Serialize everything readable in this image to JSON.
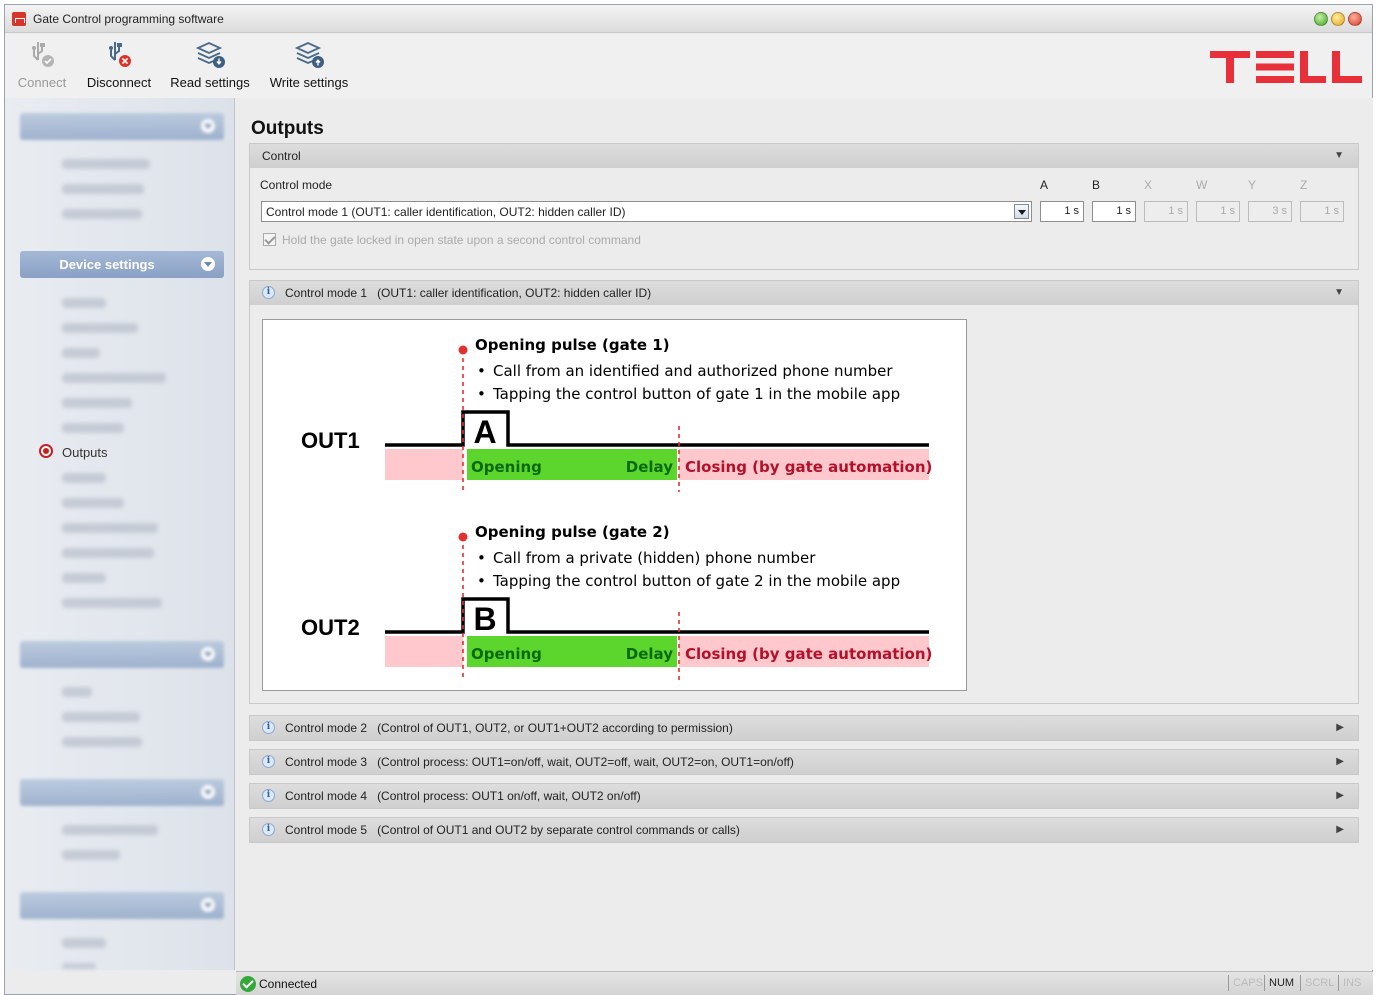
{
  "window": {
    "title": "Gate Control programming software"
  },
  "toolbar": {
    "connect": "Connect",
    "disconnect": "Disconnect",
    "read_settings": "Read settings",
    "write_settings": "Write settings",
    "logo": "TELL"
  },
  "sidebar": {
    "device_settings": "Device settings",
    "outputs": "Outputs"
  },
  "main": {
    "title": "Outputs",
    "control_panel": {
      "header": "Control",
      "control_mode_label": "Control mode",
      "selected_mode": "Control mode 1   (OUT1: caller identification, OUT2: hidden caller ID)",
      "timers": [
        {
          "label": "A",
          "value": "1 s",
          "enabled": true
        },
        {
          "label": "B",
          "value": "1 s",
          "enabled": true
        },
        {
          "label": "X",
          "value": "1 s",
          "enabled": false
        },
        {
          "label": "W",
          "value": "1 s",
          "enabled": false
        },
        {
          "label": "Y",
          "value": "3 s",
          "enabled": false
        },
        {
          "label": "Z",
          "value": "1 s",
          "enabled": false
        }
      ],
      "hold_checkbox": "Hold the gate locked in open state upon a second control command",
      "hold_checked": true
    },
    "modes": [
      {
        "name": "Control mode 1",
        "desc": "(OUT1: caller identification, OUT2: hidden caller ID)",
        "expanded": true
      },
      {
        "name": "Control mode 2",
        "desc": "(Control of OUT1, OUT2, or OUT1+OUT2 according to permission)",
        "expanded": false
      },
      {
        "name": "Control mode 3",
        "desc": "(Control process: OUT1=on/off, wait, OUT2=off, wait, OUT2=on, OUT1=on/off)",
        "expanded": false
      },
      {
        "name": "Control mode 4",
        "desc": "(Control process: OUT1 on/off, wait, OUT2 on/off)",
        "expanded": false
      },
      {
        "name": "Control mode 5",
        "desc": "(Control of OUT1 and OUT2 by separate control commands or calls)",
        "expanded": false
      }
    ],
    "diagram": {
      "out1": {
        "label": "OUT1",
        "pulse_title": "Opening pulse (gate 1)",
        "bullet1": "Call from an identified and authorized phone number",
        "bullet2": "Tapping the control button of gate 1 in the mobile app",
        "letter": "A",
        "opening": "Opening",
        "delay": "Delay",
        "closing": "Closing (by gate automation)"
      },
      "out2": {
        "label": "OUT2",
        "pulse_title": "Opening pulse (gate 2)",
        "bullet1": "Call from a private (hidden) phone number",
        "bullet2": "Tapping the control button of gate 2 in the mobile app",
        "letter": "B",
        "opening": "Opening",
        "delay": "Delay",
        "closing": "Closing (by gate automation)"
      },
      "bullet_char": "•"
    }
  },
  "statusbar": {
    "status": "Connected",
    "caps": "CAPS",
    "num": "NUM",
    "scrl": "SCRL",
    "ins": "INS"
  },
  "colors": {
    "green": "#5cd62c",
    "pink": "#ffc8cc",
    "red_marker": "#e03030",
    "logo_red": "#e8303a",
    "radio_red": "#c82020"
  }
}
